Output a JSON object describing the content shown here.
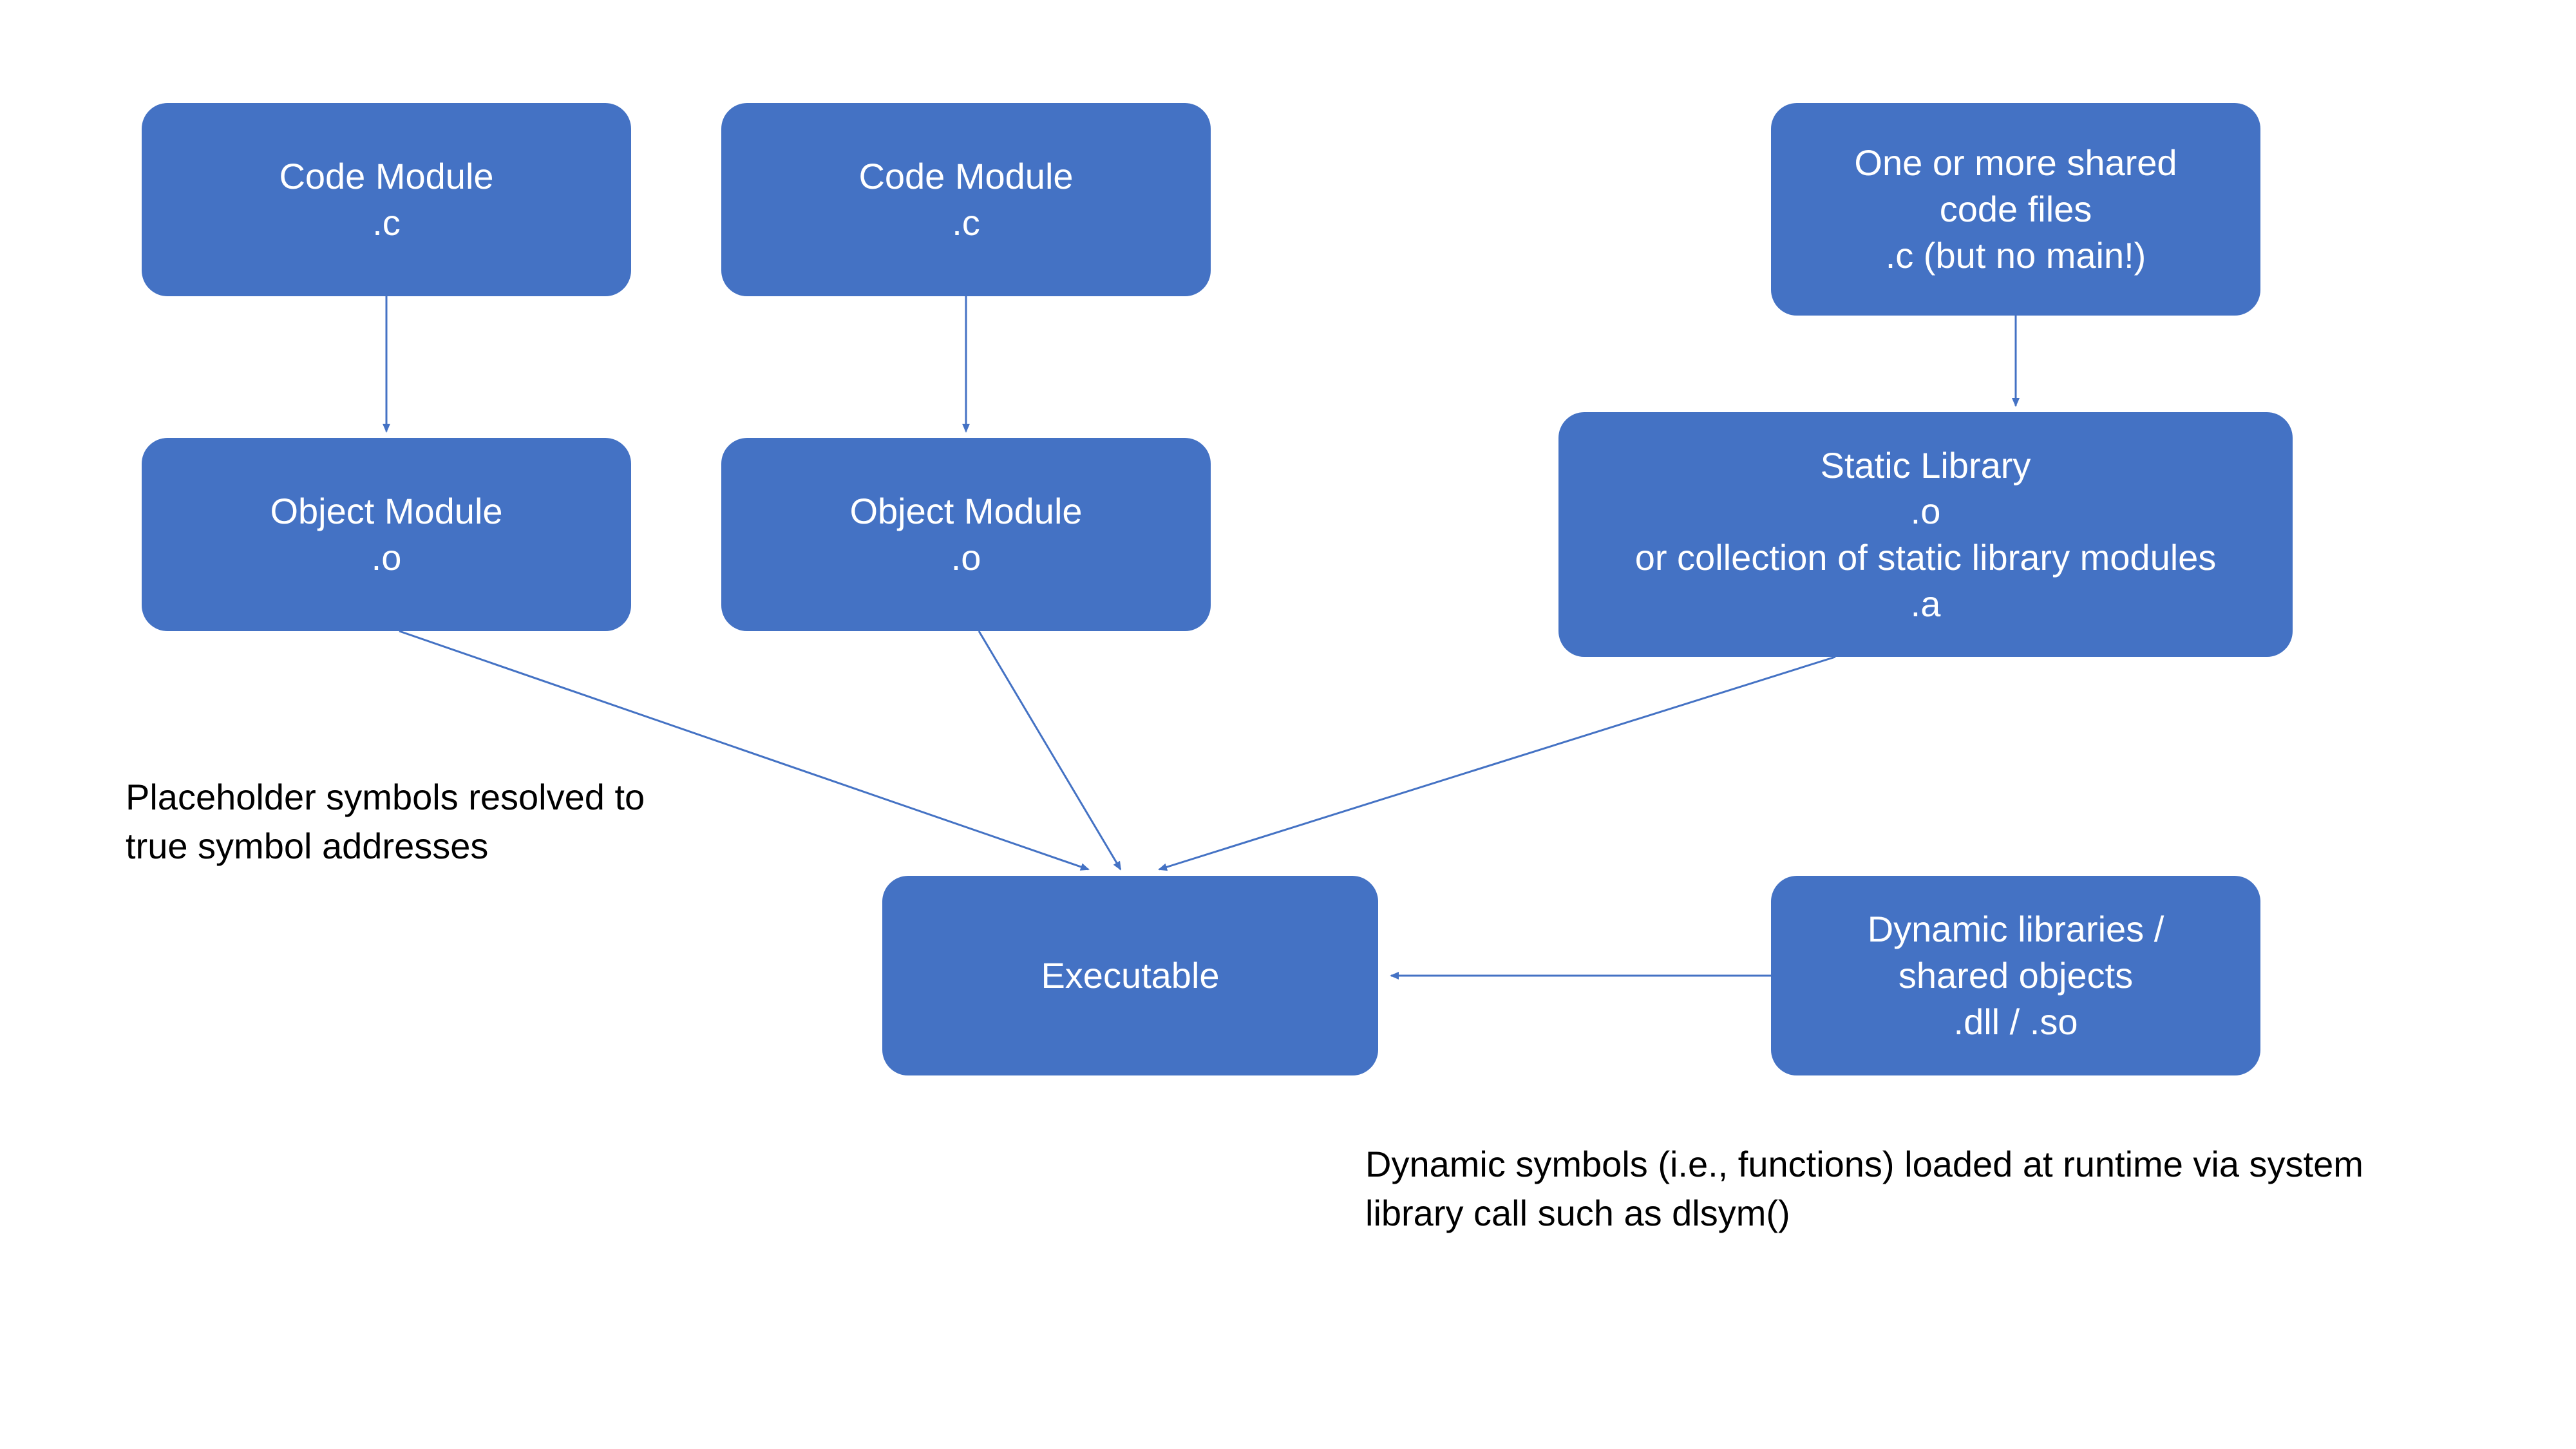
{
  "nodes": {
    "code1": {
      "line1": "Code Module",
      "line2": ".c"
    },
    "code2": {
      "line1": "Code Module",
      "line2": ".c"
    },
    "shared_code": {
      "line1": "One or more shared",
      "line2": "code files",
      "line3": ".c (but no main!)"
    },
    "obj1": {
      "line1": "Object Module",
      "line2": ".o"
    },
    "obj2": {
      "line1": "Object Module",
      "line2": ".o"
    },
    "static_lib": {
      "line1": "Static Library",
      "line2": ".o",
      "line3": "or collection of static library modules",
      "line4": ".a"
    },
    "exe": {
      "line1": "Executable"
    },
    "dynlib": {
      "line1": "Dynamic libraries /",
      "line2": "shared objects",
      "line3": ".dll / .so"
    }
  },
  "notes": {
    "placeholder": "Placeholder symbols resolved to true symbol addresses",
    "dynamic": "Dynamic symbols (i.e., functions) loaded at runtime via system library call such as dlsym()"
  },
  "colors": {
    "node_fill": "#4472C4",
    "arrow": "#4472C4",
    "text_light": "#FFFFFF",
    "text_dark": "#000000"
  }
}
